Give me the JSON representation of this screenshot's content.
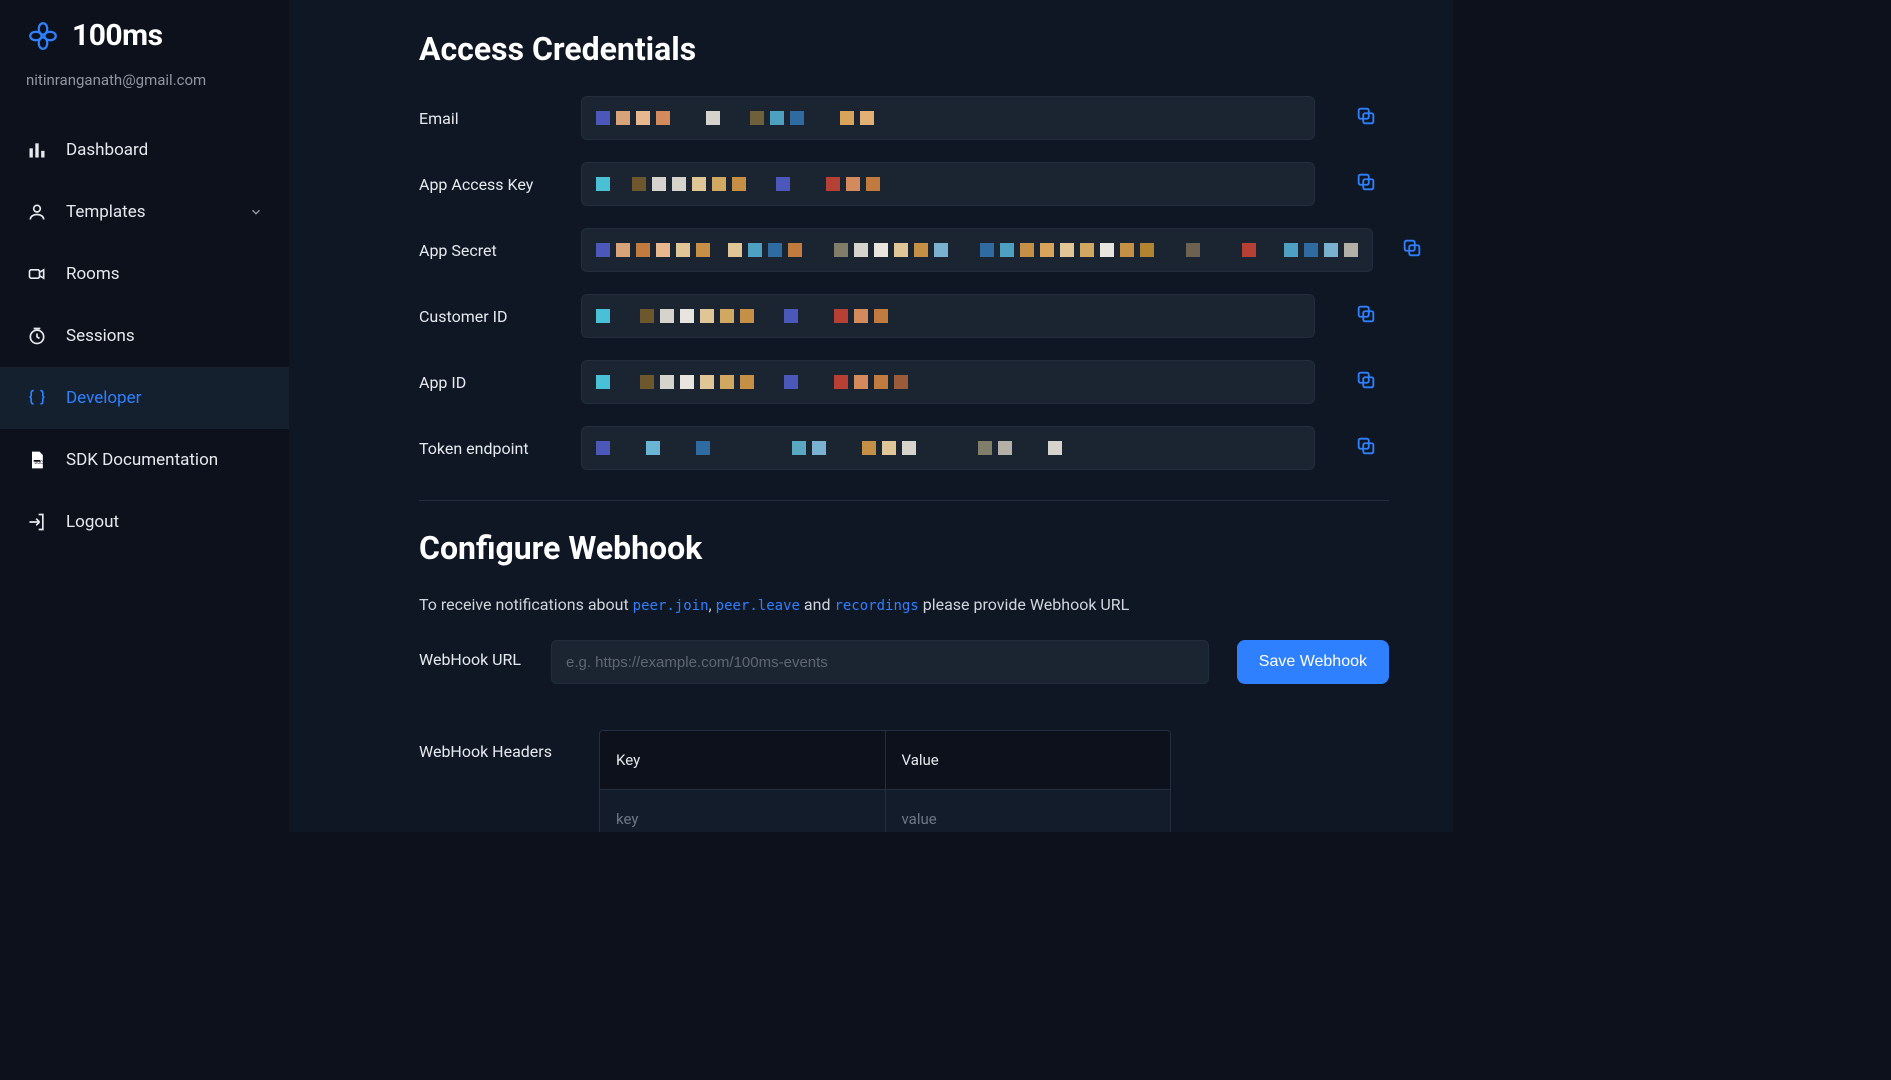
{
  "brand": {
    "name": "100ms"
  },
  "user": {
    "email": "nitinranganath@gmail.com"
  },
  "nav": {
    "items": [
      {
        "id": "dashboard",
        "label": "Dashboard",
        "icon": "bars"
      },
      {
        "id": "templates",
        "label": "Templates",
        "icon": "person",
        "expandable": true
      },
      {
        "id": "rooms",
        "label": "Rooms",
        "icon": "camera"
      },
      {
        "id": "sessions",
        "label": "Sessions",
        "icon": "clock"
      },
      {
        "id": "developer",
        "label": "Developer",
        "icon": "braces",
        "active": true
      },
      {
        "id": "docs",
        "label": "SDK Documentation",
        "icon": "doc"
      },
      {
        "id": "logout",
        "label": "Logout",
        "icon": "exit"
      }
    ]
  },
  "credentials": {
    "heading": "Access Credentials",
    "rows": [
      {
        "id": "email",
        "label": "Email",
        "masked": [
          [
            "#4b58b9",
            14
          ],
          [
            "#d7a47a",
            14
          ],
          [
            "#e7b88e",
            14
          ],
          [
            "#d38a5c",
            14
          ],
          [
            "",
            24
          ],
          [
            "#d6d2cc",
            14
          ],
          [
            "",
            18
          ],
          [
            "#6d603b",
            14
          ],
          [
            "#4ea0c2",
            14
          ],
          [
            "#2f6ba0",
            14
          ],
          [
            "",
            24
          ],
          [
            "#d8a35a",
            14
          ],
          [
            "#e2b074",
            14
          ]
        ]
      },
      {
        "id": "app_access_key",
        "label": "App Access Key",
        "masked": [
          [
            "#49c0d6",
            14
          ],
          [
            "",
            10
          ],
          [
            "#6d582e",
            14
          ],
          [
            "#d6d2cc",
            14
          ],
          [
            "#d6d2cc",
            14
          ],
          [
            "#e0c596",
            14
          ],
          [
            "#d0a862",
            14
          ],
          [
            "#c59046",
            14
          ],
          [
            "",
            18
          ],
          [
            "#4b58b9",
            14
          ],
          [
            "",
            24
          ],
          [
            "#b64034",
            14
          ],
          [
            "#d38a5c",
            14
          ],
          [
            "#c17b3e",
            14
          ]
        ]
      },
      {
        "id": "app_secret",
        "label": "App Secret",
        "masked": [
          [
            "#4b58b9",
            14
          ],
          [
            "#d7a47a",
            14
          ],
          [
            "#c17b3e",
            14
          ],
          [
            "#e7b88e",
            14
          ],
          [
            "#e0c596",
            14
          ],
          [
            "#c59046",
            14
          ],
          [
            "",
            6
          ],
          [
            "#e0c596",
            14
          ],
          [
            "#4ea0c2",
            14
          ],
          [
            "#2f6ba0",
            14
          ],
          [
            "#c17b3e",
            14
          ],
          [
            "",
            20
          ],
          [
            "#827c6a",
            14
          ],
          [
            "#d6d2cc",
            14
          ],
          [
            "#e8e4de",
            14
          ],
          [
            "#e0c596",
            14
          ],
          [
            "#c59046",
            14
          ],
          [
            "#7ab1d0",
            14
          ],
          [
            "",
            20
          ],
          [
            "#2f6ba0",
            14
          ],
          [
            "#4ea0c2",
            14
          ],
          [
            "#c59046",
            14
          ],
          [
            "#d8a35a",
            14
          ],
          [
            "#e0c596",
            14
          ],
          [
            "#d0a862",
            14
          ],
          [
            "#e8e4de",
            14
          ],
          [
            "#c59046",
            14
          ],
          [
            "#b08430",
            14
          ],
          [
            "",
            20
          ],
          [
            "#6d6152",
            14
          ],
          [
            "",
            30
          ],
          [
            "#b64034",
            14
          ],
          [
            "",
            16
          ],
          [
            "#4ea0c2",
            14
          ],
          [
            "#2f6ba0",
            14
          ],
          [
            "#7ab1d0",
            14
          ],
          [
            "#b3b0a8",
            14
          ]
        ]
      },
      {
        "id": "customer_id",
        "label": "Customer ID",
        "masked": [
          [
            "#49c0d6",
            14
          ],
          [
            "",
            18
          ],
          [
            "#6d582e",
            14
          ],
          [
            "#d6d2cc",
            14
          ],
          [
            "#e8e4de",
            14
          ],
          [
            "#e0c596",
            14
          ],
          [
            "#d0a862",
            14
          ],
          [
            "#c59046",
            14
          ],
          [
            "",
            18
          ],
          [
            "#4b58b9",
            14
          ],
          [
            "",
            24
          ],
          [
            "#b64034",
            14
          ],
          [
            "#d38a5c",
            14
          ],
          [
            "#c17b3e",
            14
          ]
        ]
      },
      {
        "id": "app_id",
        "label": "App ID",
        "masked": [
          [
            "#49c0d6",
            14
          ],
          [
            "",
            18
          ],
          [
            "#6d582e",
            14
          ],
          [
            "#d6d2cc",
            14
          ],
          [
            "#e8e4de",
            14
          ],
          [
            "#e0c596",
            14
          ],
          [
            "#d0a862",
            14
          ],
          [
            "#c59046",
            14
          ],
          [
            "",
            18
          ],
          [
            "#4b58b9",
            14
          ],
          [
            "",
            24
          ],
          [
            "#b64034",
            14
          ],
          [
            "#d38a5c",
            14
          ],
          [
            "#c17b3e",
            14
          ],
          [
            "#9a5b3a",
            14
          ]
        ]
      },
      {
        "id": "token_endpoint",
        "label": "Token endpoint",
        "masked": [
          [
            "#4b58b9",
            14
          ],
          [
            "",
            24
          ],
          [
            "#6ab4d6",
            14
          ],
          [
            "",
            24
          ],
          [
            "#2f6ba0",
            14
          ],
          [
            "",
            70
          ],
          [
            "#5aa7c2",
            14
          ],
          [
            "#7ab1d0",
            14
          ],
          [
            "",
            24
          ],
          [
            "#c59046",
            14
          ],
          [
            "#e0c596",
            14
          ],
          [
            "#d6d2cc",
            14
          ],
          [
            "",
            50
          ],
          [
            "#827c6a",
            14
          ],
          [
            "#b3b0a8",
            14
          ],
          [
            "",
            24
          ],
          [
            "#d6d2cc",
            14
          ]
        ]
      }
    ]
  },
  "webhook": {
    "heading": "Configure Webhook",
    "description": {
      "pre": "To receive notifications about ",
      "code1": "peer.join",
      "sep1": ", ",
      "code2": "peer.leave",
      "sep2": " and ",
      "code3": "recordings",
      "post": " please provide Webhook URL"
    },
    "url_label": "WebHook URL",
    "url_placeholder": "e.g. https://example.com/100ms-events",
    "save_label": "Save Webhook",
    "headers_label": "WebHook Headers",
    "headers_table": {
      "col_key": "Key",
      "col_value": "Value",
      "placeholder_key": "key",
      "placeholder_value": "value"
    }
  }
}
